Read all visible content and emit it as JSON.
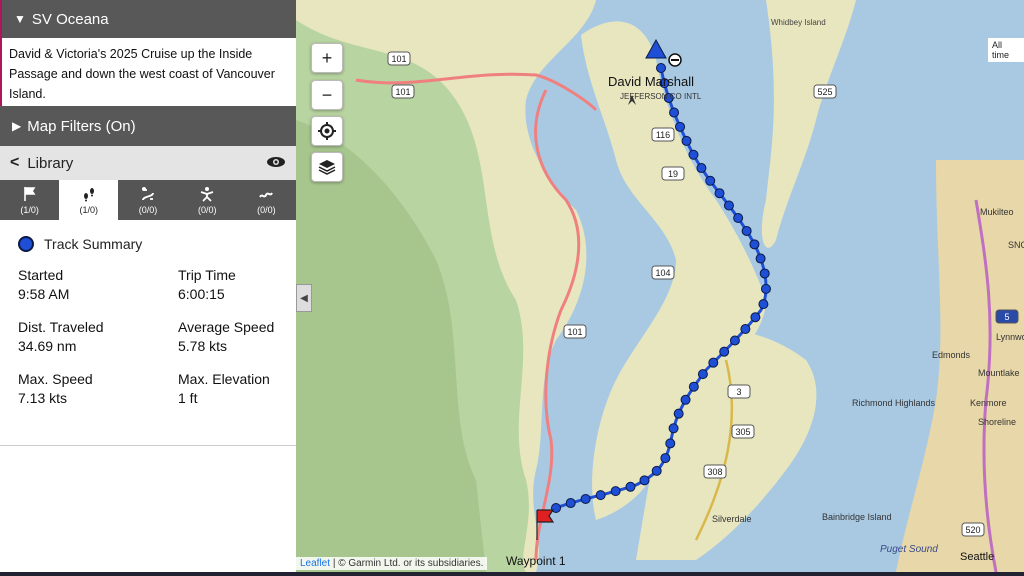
{
  "panel": {
    "vessel_name": "SV Oceana",
    "description": "David & Victoria's 2025 Cruise up the Inside Passage and down the west coast of Vancouver Island.",
    "filters_label": "Map Filters (On)",
    "library_label": "Library",
    "tabs": [
      {
        "icon": "flag-icon",
        "count": "(1/0)"
      },
      {
        "icon": "footprints-icon",
        "count": "(1/0)"
      },
      {
        "icon": "route-icon",
        "count": "(0/0)"
      },
      {
        "icon": "person-icon",
        "count": "(0/0)"
      },
      {
        "icon": "trail-icon",
        "count": "(0/0)"
      }
    ],
    "summary": {
      "title": "Track Summary",
      "started_label": "Started",
      "started_value": "9:58 AM",
      "trip_time_label": "Trip Time",
      "trip_time_value": "6:00:15",
      "dist_label": "Dist. Traveled",
      "dist_value": "34.69 nm",
      "avg_speed_label": "Average Speed",
      "avg_speed_value": "5.78 kts",
      "max_speed_label": "Max. Speed",
      "max_speed_value": "7.13 kts",
      "max_elev_label": "Max. Elevation",
      "max_elev_value": "1 ft"
    }
  },
  "map": {
    "zoom_in": "+",
    "zoom_out": "−",
    "all_time_label": "All time",
    "attribution_link": "Leaflet",
    "attribution_text": "| © Garmin Ltd. or its subsidiaries.",
    "labels": {
      "david_marshall": "David Marshall",
      "jefferson": "JEFFERSON CO INTL",
      "waypoint": "Waypoint 1",
      "whidbey": "Whidbey Island",
      "mukilteo": "Mukilteo",
      "edmonds": "Edmonds",
      "lynnwood": "Lynnwood",
      "mountlake": "Mountlake",
      "kenmore": "Kenmore",
      "shoreline": "Shoreline",
      "richmond": "Richmond Highlands",
      "silverdale": "Silverdale",
      "bainbridge": "Bainbridge Island",
      "puget": "Puget Sound",
      "seattle": "Seattle",
      "snoh": "SNOH"
    },
    "shields": [
      "101",
      "101",
      "101",
      "116",
      "19",
      "104",
      "3",
      "305",
      "308",
      "525",
      "5",
      "520"
    ],
    "colors": {
      "water": "#a9c9e2",
      "land": "#e8e6bf",
      "forest": "#b8d4a0",
      "track": "#1e4fd6",
      "road": "#f08080"
    }
  }
}
